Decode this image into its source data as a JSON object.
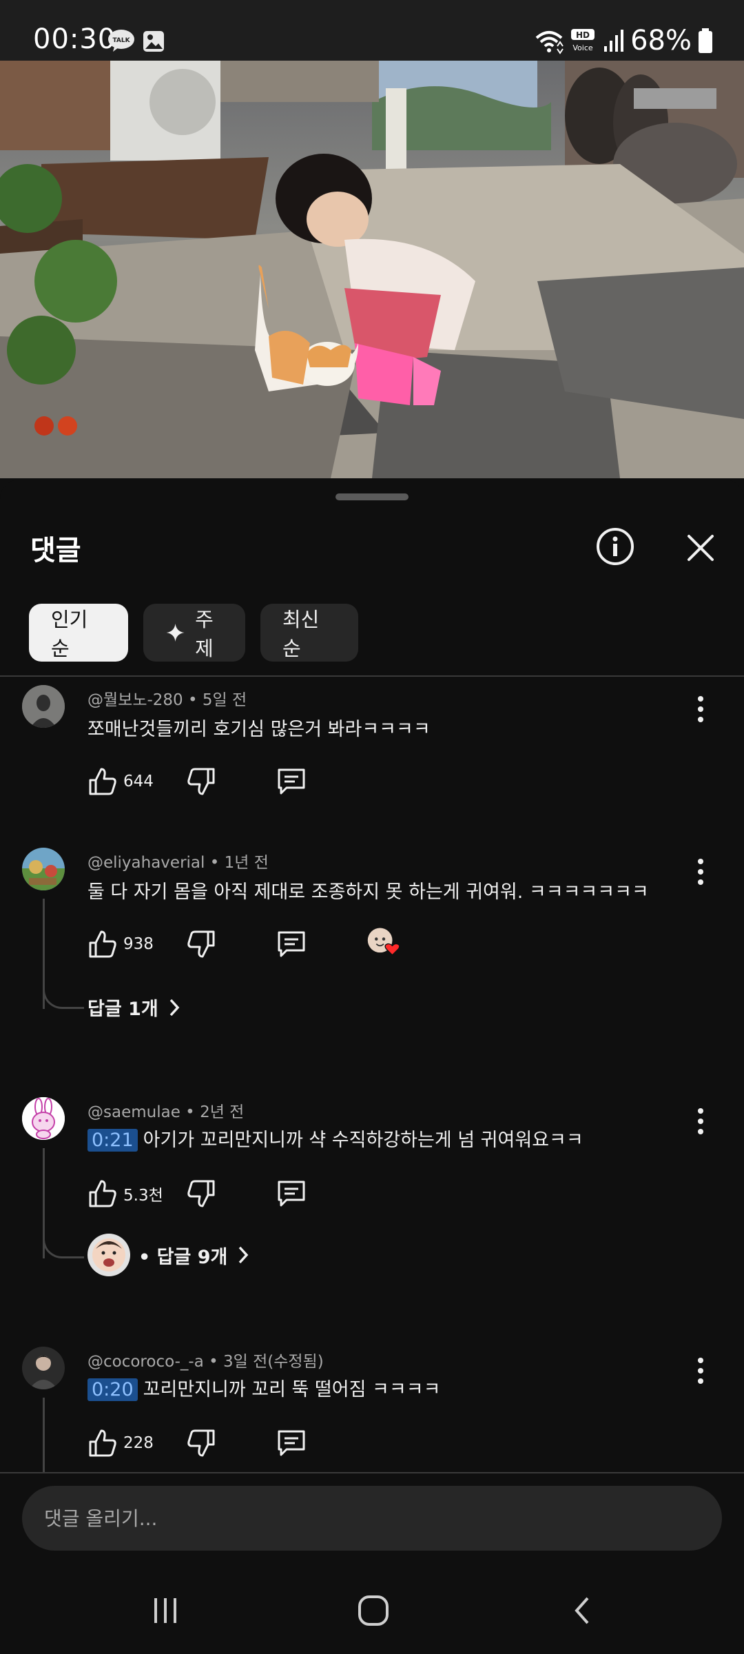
{
  "status_bar": {
    "time": "00:30",
    "talk_badge": "TALK",
    "hd_badge": "HD",
    "voice_badge": "Voice",
    "battery": "68%"
  },
  "sheet": {
    "title": "댓글",
    "chips": [
      {
        "label": "인기순",
        "active": true
      },
      {
        "label": "주제",
        "active": false,
        "icon": "sparkle-icon"
      },
      {
        "label": "최신순",
        "active": false
      }
    ]
  },
  "comments": [
    {
      "author": "@뭘보노-280",
      "age": "5일 전",
      "text": "쪼매난것들끼리 호기심 많은거 봐라ㅋㅋㅋㅋ",
      "likes": "644"
    },
    {
      "author": "@eliyahaverial",
      "age": "1년 전",
      "text": "둘 다 자기 몸을 아직 제대로 조종하지 못 하는게 귀여워. ㅋㅋㅋㅋㅋㅋㅋ",
      "likes": "938",
      "replies": "답글 1개"
    },
    {
      "author": "@saemulae",
      "age": "2년 전",
      "timestamp": "0:21",
      "text": "아기가 꼬리만지니까 샥 수직하강하는게 넘 귀여워요ㅋㅋ",
      "likes": "5.3천",
      "replies": "• 답글 9개"
    },
    {
      "author": "@cocoroco-_-a",
      "age": "3일 전(수정됨)",
      "timestamp": "0:20",
      "text": "꼬리만지니까 꼬리 뚝 떨어짐 ㅋㅋㅋㅋ",
      "likes": "228"
    }
  ],
  "input": {
    "placeholder": "댓글 올리기..."
  },
  "colors": {
    "background": "#0f0f0f",
    "chip": "#272727",
    "timestamp_bg": "#1b4f8f",
    "timestamp_fg": "#8fc1ff",
    "heart": "#ff2a2a"
  }
}
